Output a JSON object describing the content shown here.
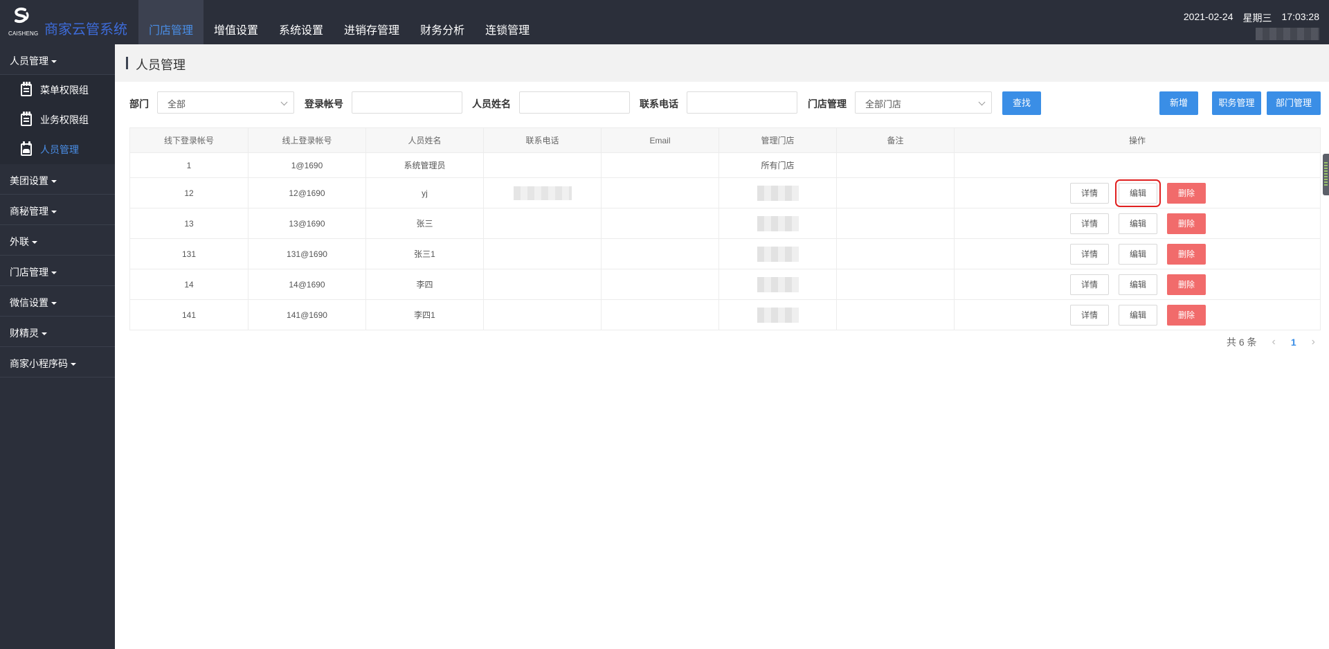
{
  "header": {
    "logo_text": "CAISHENG",
    "brand": "商家云管系统",
    "nav": [
      "门店管理",
      "增值设置",
      "系统设置",
      "进销存管理",
      "财务分析",
      "连锁管理"
    ],
    "date": "2021-02-24",
    "weekday": "星期三",
    "time": "17:03:28"
  },
  "sidebar": {
    "group_personnel": "人员管理",
    "sub_items": [
      "菜单权限组",
      "业务权限组",
      "人员管理"
    ],
    "groups": [
      "美团设置",
      "商秘管理",
      "外联",
      "门店管理",
      "微信设置",
      "财精灵",
      "商家小程序码"
    ]
  },
  "page": {
    "title": "人员管理"
  },
  "filter": {
    "dept_label": "部门",
    "dept_value": "全部",
    "login_label": "登录帐号",
    "login_value": "",
    "name_label": "人员姓名",
    "name_value": "",
    "phone_label": "联系电话",
    "phone_value": "",
    "store_label": "门店管理",
    "store_value": "全部门店",
    "search_btn": "查找",
    "add_btn": "新增",
    "role_btn": "职务管理",
    "dept_btn": "部门管理"
  },
  "table": {
    "headers": [
      "线下登录帐号",
      "线上登录帐号",
      "人员姓名",
      "联系电话",
      "Email",
      "管理门店",
      "备注",
      "操作"
    ],
    "rows": [
      {
        "offline": "1",
        "online": "1@1690",
        "name": "系统管理员",
        "store": "所有门店"
      },
      {
        "offline": "12",
        "online": "12@1690",
        "name": "yj"
      },
      {
        "offline": "13",
        "online": "13@1690",
        "name": "张三"
      },
      {
        "offline": "131",
        "online": "131@1690",
        "name": "张三1"
      },
      {
        "offline": "14",
        "online": "14@1690",
        "name": "李四"
      },
      {
        "offline": "141",
        "online": "141@1690",
        "name": "李四1"
      }
    ],
    "op_detail": "详情",
    "op_edit": "编辑",
    "op_delete": "删除"
  },
  "pagination": {
    "total": "共 6 条",
    "current": "1"
  },
  "colors": {
    "topbar": "#2b2f3a",
    "accent": "#3a8ee6",
    "danger": "#f16b6b",
    "highlight": "#e01f1f"
  }
}
